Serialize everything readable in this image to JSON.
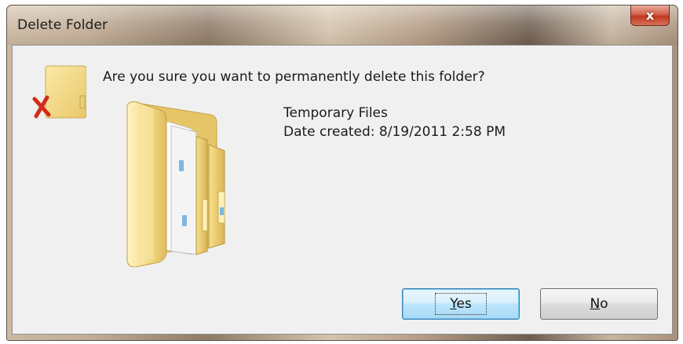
{
  "window": {
    "title": "Delete Folder",
    "close_label": "x"
  },
  "dialog": {
    "question": "Are you sure you want to permanently delete this folder?",
    "item_name": "Temporary Files",
    "item_date": "Date created: 8/19/2011 2:58 PM"
  },
  "buttons": {
    "yes_mnemonic": "Y",
    "yes_rest": "es",
    "no_mnemonic": "N",
    "no_rest": "o"
  },
  "icons": {
    "small": "delete-folder-icon",
    "large": "folder-icon"
  },
  "colors": {
    "default_button_border": "#3c7fb1",
    "delete_x": "#d42a1a",
    "folder": "#f3d98a"
  }
}
